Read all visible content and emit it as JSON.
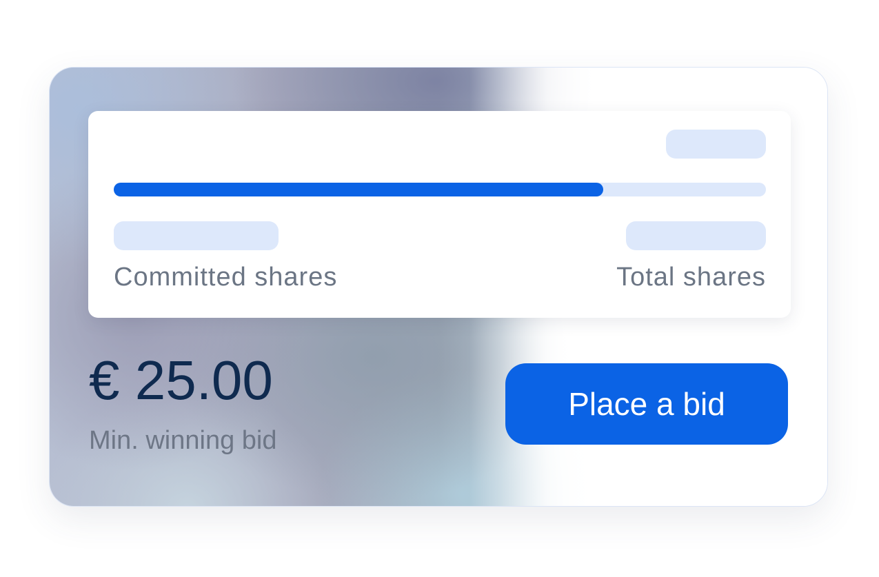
{
  "panel": {
    "progress": {
      "value": 0.75,
      "color": "#0b63e5",
      "track_color": "#dde8fb"
    },
    "committed_label": "Committed shares",
    "total_label": "Total shares"
  },
  "bid": {
    "price": "€ 25.00",
    "min_label": "Min. winning bid",
    "button_label": "Place a bid"
  },
  "colors": {
    "accent": "#0b63e5",
    "price_text": "#0f2a4f",
    "muted_text": "#6b7584",
    "skeleton": "#dde8fb"
  }
}
